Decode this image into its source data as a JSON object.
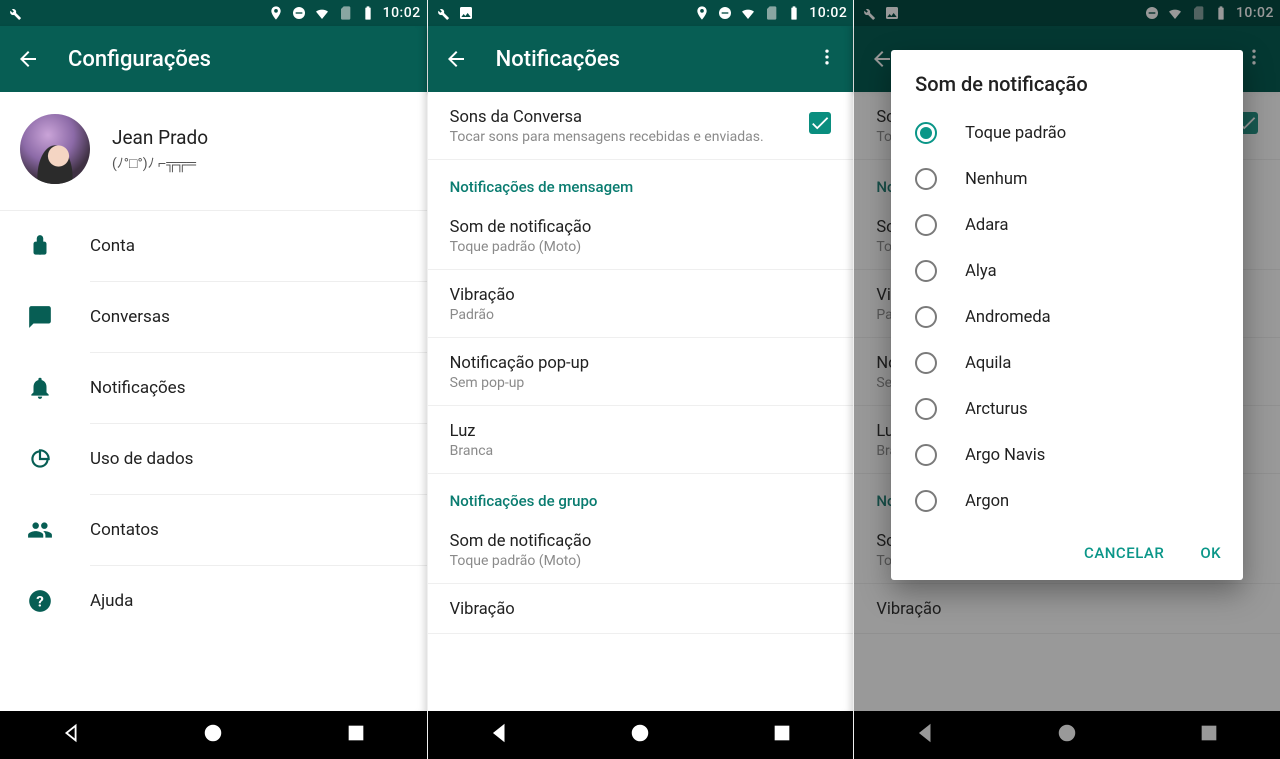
{
  "statusbar": {
    "time": "10:02"
  },
  "screen1": {
    "title": "Configurações",
    "profile": {
      "name": "Jean Prado",
      "status": "(ﾉ°□°)ﾉ ⌐╦╦═"
    },
    "items": [
      {
        "id": "conta",
        "label": "Conta"
      },
      {
        "id": "conversas",
        "label": "Conversas"
      },
      {
        "id": "notificacoes",
        "label": "Notificações"
      },
      {
        "id": "dados",
        "label": "Uso de dados"
      },
      {
        "id": "contatos",
        "label": "Contatos"
      },
      {
        "id": "ajuda",
        "label": "Ajuda"
      }
    ]
  },
  "screen2": {
    "title": "Notificações",
    "sounds_title": "Sons da Conversa",
    "sounds_sub": "Tocar sons para mensagens recebidas e enviadas.",
    "section_msg": "Notificações de mensagem",
    "items_msg": [
      {
        "title": "Som de notificação",
        "sub": "Toque padrão (Moto)"
      },
      {
        "title": "Vibração",
        "sub": "Padrão"
      },
      {
        "title": "Notificação pop-up",
        "sub": "Sem pop-up"
      },
      {
        "title": "Luz",
        "sub": "Branca"
      }
    ],
    "section_group": "Notificações de grupo",
    "items_group": [
      {
        "title": "Som de notificação",
        "sub": "Toque padrão (Moto)"
      },
      {
        "title": "Vibração",
        "sub": ""
      }
    ]
  },
  "dialog": {
    "title": "Som de notificação",
    "options": [
      "Toque padrão",
      "Nenhum",
      "Adara",
      "Alya",
      "Andromeda",
      "Aquila",
      "Arcturus",
      "Argo Navis",
      "Argon"
    ],
    "selected_index": 0,
    "cancel": "CANCELAR",
    "ok": "OK"
  },
  "ghost": {
    "sounds_title": "So",
    "sounds_sub": "Toc",
    "section_msg": "Not",
    "msg0_t": "So",
    "msg0_s": "Toc",
    "msg1_t": "Vib",
    "msg1_s": "Pa",
    "msg2_t": "No",
    "msg2_s": "Se",
    "msg3_t": "Lu",
    "msg3_s": "Bra",
    "section_group": "Not",
    "g0_t": "So",
    "g0_s": "Toc",
    "g1_t": "Vibração"
  }
}
